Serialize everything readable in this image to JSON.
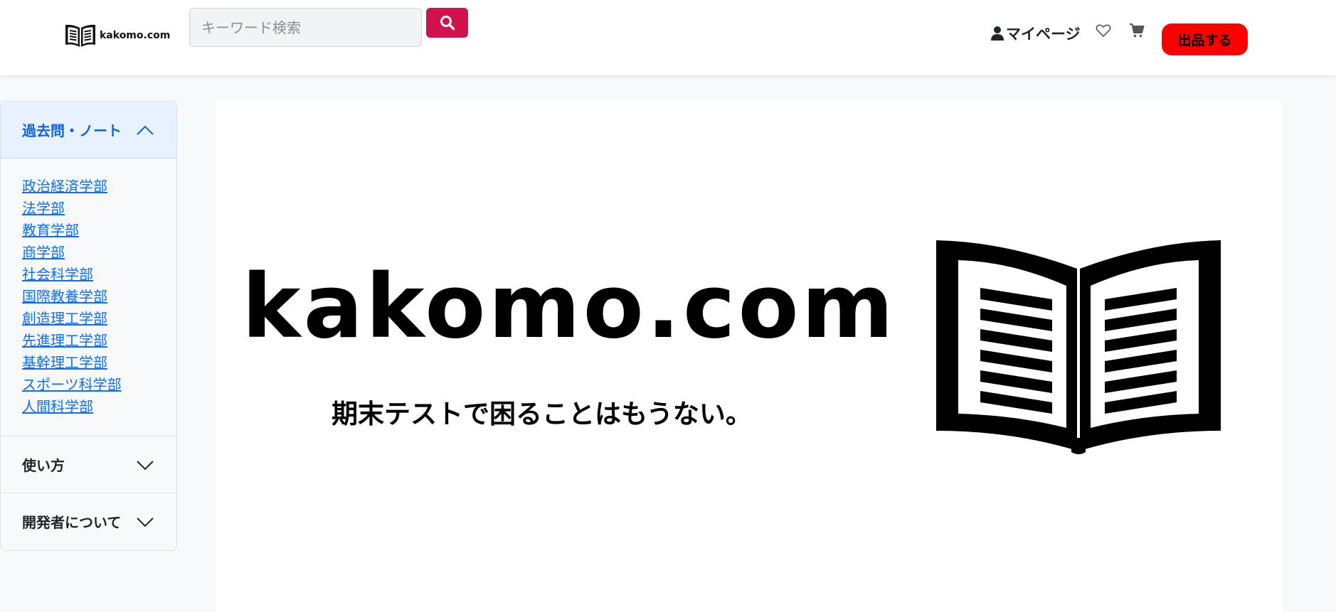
{
  "header": {
    "logo_text": "kakomo.com",
    "search_placeholder": "キーワード検索",
    "mypage_label": "マイページ",
    "sell_label": "出品する"
  },
  "sidebar": {
    "sections": [
      {
        "title": "過去問・ノート",
        "expanded": true,
        "items": [
          "政治経済学部",
          "法学部",
          "教育学部",
          "商学部",
          "社会科学部",
          "国際教養学部",
          "創造理工学部",
          "先進理工学部",
          "基幹理工学部",
          "スポーツ科学部",
          "人間科学部"
        ]
      },
      {
        "title": "使い方",
        "expanded": false
      },
      {
        "title": "開発者について",
        "expanded": false
      }
    ]
  },
  "hero": {
    "wordmark": "kakomo.com",
    "tagline": "期末テストで困ることはもうない。"
  },
  "icons": {
    "logo": "open-book-icon",
    "search": "search-icon",
    "user": "user-icon",
    "favorites": "heart-icon",
    "cart": "cart-icon",
    "expanded": "chevron-up-icon",
    "collapsed": "chevron-down-icon"
  },
  "colors": {
    "search_button": "#d0134f",
    "sell_button": "#ff0000",
    "link": "#0d6efd",
    "accordion_active_bg": "#e7f1ff",
    "accordion_active_text": "#0c63e4"
  }
}
